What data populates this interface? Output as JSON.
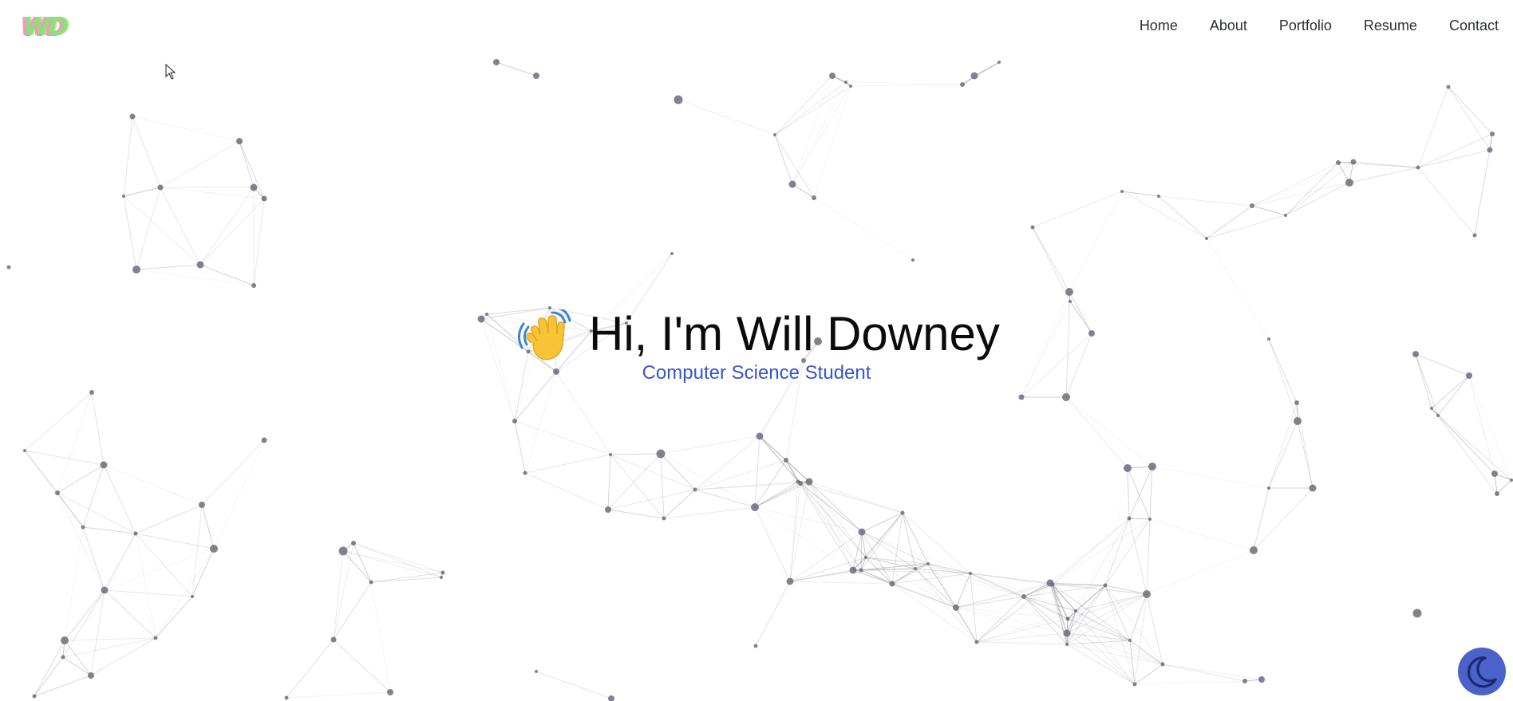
{
  "logo": {
    "text": "WD"
  },
  "nav": {
    "items": [
      "Home",
      "About",
      "Portfolio",
      "Resume",
      "Contact"
    ]
  },
  "hero": {
    "title": "Hi, I'm Will Downey",
    "subtitle": "Computer Science Student",
    "emoji": "waving-hand-icon"
  },
  "theme_toggle": {
    "icon": "moon-icon"
  },
  "colors": {
    "accent": "#3a55c8",
    "toggle_bg": "#4a62c9",
    "node": "#6b6f7a",
    "edge": "#9a9ca3",
    "text": "#0b0b0b",
    "nav_text": "#2b2f36"
  }
}
